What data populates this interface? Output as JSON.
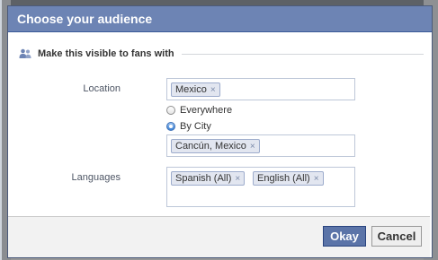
{
  "dialog": {
    "title": "Choose your audience",
    "section_title": "Make this visible to fans with"
  },
  "location": {
    "label": "Location",
    "token": "Mexico",
    "options": [
      {
        "label": "Everywhere",
        "checked": false
      },
      {
        "label": "By City",
        "checked": true
      }
    ],
    "city_token": "Cancún, Mexico"
  },
  "languages": {
    "label": "Languages",
    "tokens": [
      "Spanish (All)",
      "English (All)"
    ]
  },
  "buttons": {
    "okay": "Okay",
    "cancel": "Cancel"
  },
  "icons": {
    "people": "people-icon",
    "remove": "remove-token-icon",
    "remove_glyph": "×"
  },
  "colors": {
    "title_bar": "#6d84b4",
    "okay_button": "#5b74a8"
  }
}
